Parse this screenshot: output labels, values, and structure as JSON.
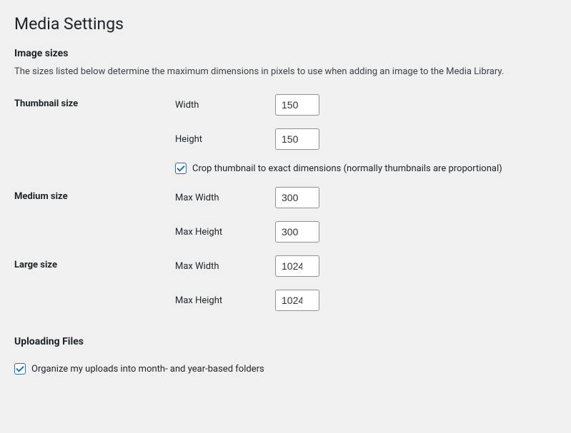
{
  "page_title": "Media Settings",
  "image_sizes": {
    "heading": "Image sizes",
    "description": "The sizes listed below determine the maximum dimensions in pixels to use when adding an image to the Media Library.",
    "thumbnail": {
      "label": "Thumbnail size",
      "width_label": "Width",
      "width_value": "150",
      "height_label": "Height",
      "height_value": "150",
      "crop_label": "Crop thumbnail to exact dimensions (normally thumbnails are proportional)",
      "crop_checked": true
    },
    "medium": {
      "label": "Medium size",
      "max_width_label": "Max Width",
      "max_width_value": "300",
      "max_height_label": "Max Height",
      "max_height_value": "300"
    },
    "large": {
      "label": "Large size",
      "max_width_label": "Max Width",
      "max_width_value": "1024",
      "max_height_label": "Max Height",
      "max_height_value": "1024"
    }
  },
  "uploading": {
    "heading": "Uploading Files",
    "organize_label": "Organize my uploads into month- and year-based folders",
    "organize_checked": true
  }
}
